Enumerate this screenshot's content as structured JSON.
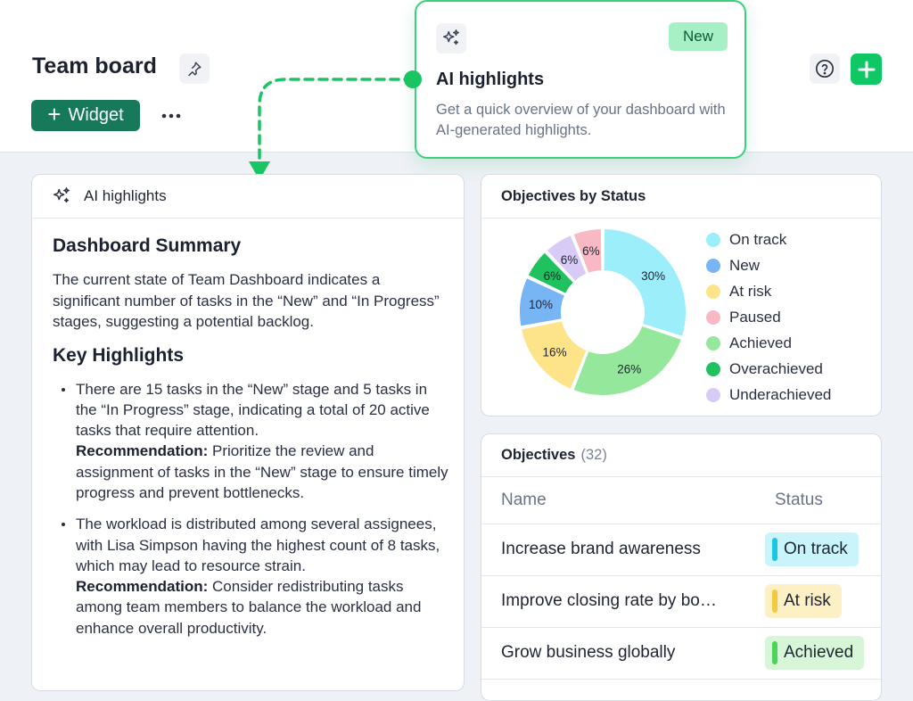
{
  "header": {
    "title": "Team board",
    "widget_label": "Widget"
  },
  "popover": {
    "badge": "New",
    "title": "AI highlights",
    "description": "Get a quick overview of your dashboard with AI-generated highlights."
  },
  "ai_card": {
    "title": "AI highlights",
    "summary_heading": "Dashboard Summary",
    "summary_text": "The current state of Team Dashboard indicates a significant number of tasks in the “New” and “In Progress” stages, suggesting a potential backlog.",
    "key_heading": "Key Highlights",
    "recommendation_label": "Recommendation:",
    "bullets": [
      {
        "text": "There are 15 tasks in the “New” stage and 5 tasks in the “In Progress” stage, indicating a total of 20 active tasks that require attention.",
        "recommendation": "Prioritize the review and assignment of tasks in the “New” stage to ensure timely progress and prevent bottlenecks."
      },
      {
        "text": "The workload is distributed among several assignees, with Lisa Simpson having the highest count of 8 tasks, which may lead to resource strain.",
        "recommendation": "Consider redistributing tasks among team members to balance the workload and enhance overall productivity."
      }
    ]
  },
  "status_card": {
    "title": "Objectives by Status"
  },
  "chart_data": {
    "type": "pie",
    "title": "Objectives by Status",
    "donut": true,
    "legend_position": "right",
    "slices": [
      {
        "label": "On track",
        "value": 30,
        "display": "30%",
        "color": "#9beefa"
      },
      {
        "label": "Achieved",
        "value": 26,
        "display": "26%",
        "color": "#95e89b"
      },
      {
        "label": "At risk",
        "value": 16,
        "display": "16%",
        "color": "#fde489"
      },
      {
        "label": "New",
        "value": 10,
        "display": "10%",
        "color": "#78b5f5"
      },
      {
        "label": "Overachieved",
        "value": 6,
        "display": "6%",
        "color": "#1fc25f"
      },
      {
        "label": "Underachieved",
        "value": 6,
        "display": "6%",
        "color": "#d9cbf7"
      },
      {
        "label": "Paused",
        "value": 6,
        "display": "6%",
        "color": "#f8b8c4"
      }
    ],
    "legend": [
      {
        "label": "On track",
        "color": "#9beefa"
      },
      {
        "label": "New",
        "color": "#78b5f5"
      },
      {
        "label": "At risk",
        "color": "#fde489"
      },
      {
        "label": "Paused",
        "color": "#f8b8c4"
      },
      {
        "label": "Achieved",
        "color": "#95e89b"
      },
      {
        "label": "Overachieved",
        "color": "#1fc25f"
      },
      {
        "label": "Underachieved",
        "color": "#d9cbf7"
      }
    ]
  },
  "objectives_card": {
    "title": "Objectives",
    "count": "(32)",
    "col_name": "Name",
    "col_status": "Status",
    "rows": [
      {
        "name": "Increase brand awareness",
        "status": "On track",
        "bg": "#c9f4fb",
        "bar": "#1cc6e0"
      },
      {
        "name": "Improve closing rate by bo…",
        "status": "At risk",
        "bg": "#fdf0c4",
        "bar": "#f5c842"
      },
      {
        "name": "Grow business globally",
        "status": "Achieved",
        "bg": "#d6f6d7",
        "bar": "#4bd35a"
      }
    ]
  },
  "colors": {
    "brand_green": "#15795a",
    "accent_green": "#10c766",
    "popover_border": "#3bd17a"
  }
}
